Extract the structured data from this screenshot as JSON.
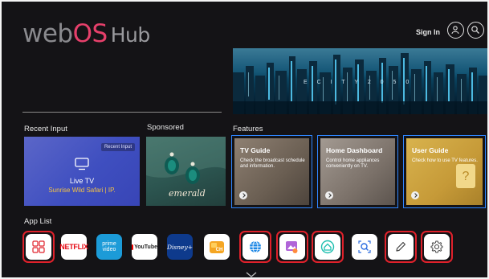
{
  "header": {
    "logo_web": "web",
    "logo_os": "OS",
    "logo_hub": "Hub",
    "sign_in": "Sign In",
    "icons": [
      "user-icon",
      "search-icon"
    ]
  },
  "banner": {
    "text": "E C I T Y   2 0 5 0"
  },
  "sections": {
    "recent_input": "Recent Input",
    "sponsored": "Sponsored",
    "features": "Features",
    "app_list": "App List"
  },
  "recent_input_card": {
    "tag": "Recent Input",
    "title": "Live TV",
    "subtitle": "Sunrise Wild Safari | IP."
  },
  "sponsored_card": {
    "brand": "emerald"
  },
  "features": [
    {
      "title": "TV Guide",
      "desc": "Check the broadcast schedule and information."
    },
    {
      "title": "Home Dashboard",
      "desc": "Control home appliances conveniently on TV."
    },
    {
      "title": "User Guide",
      "desc": "Check how to use TV features."
    }
  ],
  "apps": [
    {
      "name": "Apps",
      "icon": "grid-icon",
      "selected": true
    },
    {
      "name": "NETFLIX",
      "selected": false
    },
    {
      "name": "prime video",
      "selected": false
    },
    {
      "name": "YouTube",
      "selected": false
    },
    {
      "name": "Disney+",
      "selected": false
    },
    {
      "name": "CH",
      "selected": false
    },
    {
      "name": "Web Browser",
      "icon": "globe-icon",
      "selected": true
    },
    {
      "name": "Gallery",
      "icon": "gallery-icon",
      "selected": true
    },
    {
      "name": "Home",
      "icon": "home-icon",
      "selected": true
    },
    {
      "name": "Search",
      "icon": "search-icon",
      "selected": false
    },
    {
      "name": "Edit",
      "icon": "pencil-icon",
      "selected": true
    },
    {
      "name": "Settings",
      "icon": "gear-icon",
      "selected": true
    }
  ],
  "colors": {
    "background": "#141316",
    "logo_accent": "#e6406b",
    "focus_blue": "#2f86ff",
    "highlight_red": "#e0212b",
    "live_tv": "#4451c0",
    "subtitle_yellow": "#f3c244"
  }
}
